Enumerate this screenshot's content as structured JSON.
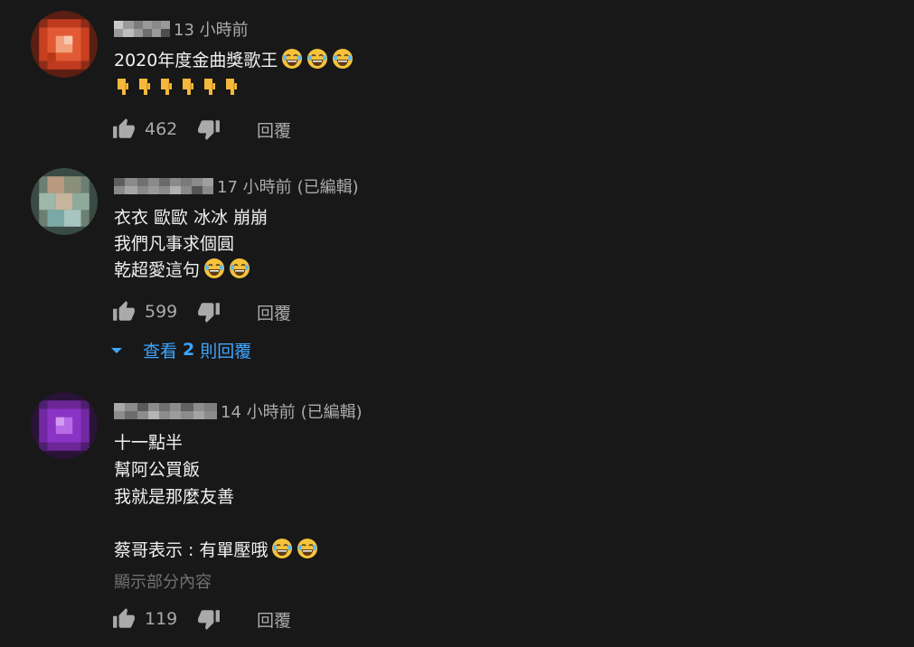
{
  "colors": {
    "background": "#181818",
    "text_primary": "#f1f1f1",
    "text_secondary": "#aaaaaa",
    "link_blue": "#3ea6ff",
    "emoji_face": "#f5c33b"
  },
  "comments": [
    {
      "time": "13 小時前",
      "edited": "",
      "lines": [
        "2020年度金曲獎歌王",
        ""
      ],
      "line1_emoji_count": 3,
      "line2_pointing_down_count": 6,
      "likes": "462",
      "reply_label": "回覆",
      "avatar_color": "#d4472a"
    },
    {
      "time": "17 小時前",
      "edited": "(已編輯)",
      "lines": [
        "衣衣 歐歐 冰冰 崩崩",
        "我們凡事求個圓",
        "乾超愛這句"
      ],
      "line3_emoji_count": 2,
      "likes": "599",
      "reply_label": "回覆",
      "view_replies": {
        "prefix": "查看",
        "count": "2",
        "suffix": "則回覆"
      },
      "avatar_color": "#8fa59a"
    },
    {
      "time": "14 小時前",
      "edited": "(已編輯)",
      "lines": [
        "十一點半",
        "幫阿公買飯",
        "我就是那麼友善",
        "",
        "蔡哥表示 : 有單壓哦"
      ],
      "line5_emoji_count": 2,
      "show_more": "顯示部分內容",
      "likes": "119",
      "reply_label": "回覆",
      "avatar_color": "#8a2fc0"
    }
  ]
}
